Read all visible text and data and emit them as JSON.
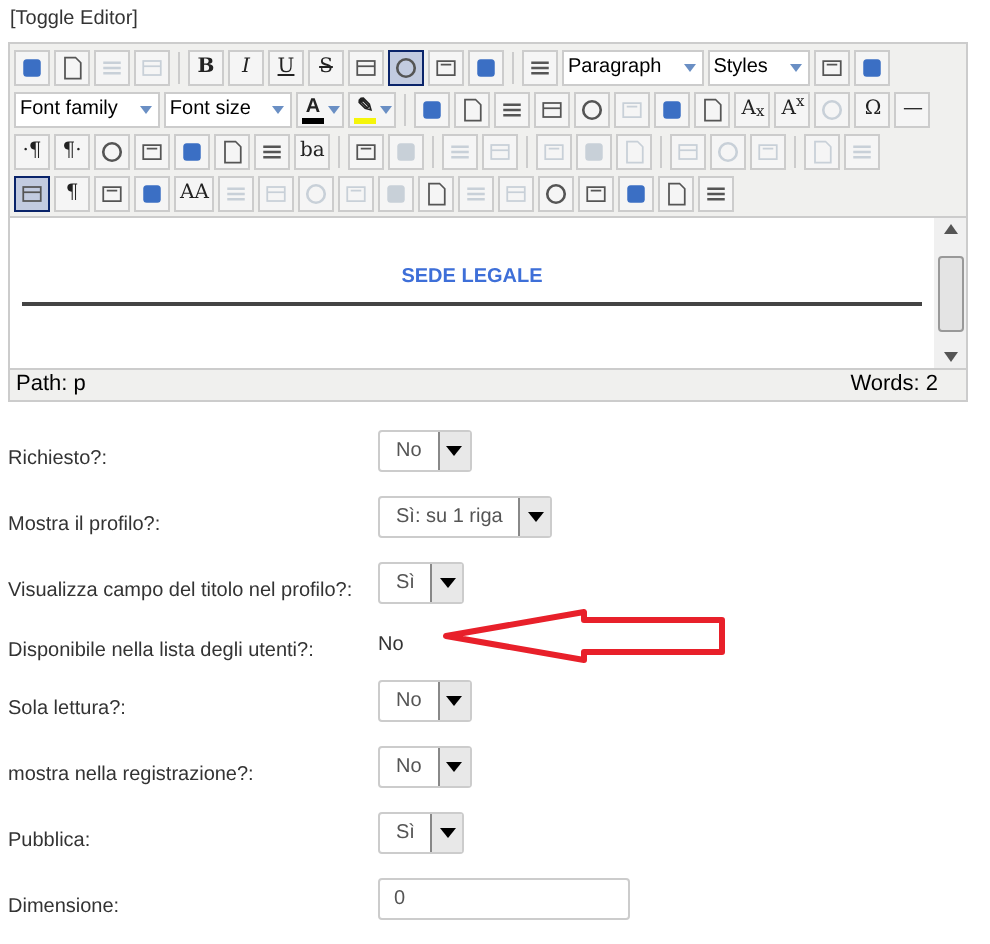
{
  "toggle_link": "[Toggle Editor]",
  "toolbar_rows": [
    [
      {
        "kind": "icon"
      },
      {
        "kind": "icon"
      },
      {
        "kind": "icon",
        "disabled": true
      },
      {
        "kind": "icon",
        "disabled": true
      },
      {
        "kind": "sep"
      },
      {
        "kind": "text",
        "label": "B",
        "bold": true
      },
      {
        "kind": "text",
        "label": "I",
        "italic": true
      },
      {
        "kind": "text",
        "label": "U",
        "underline": true
      },
      {
        "kind": "text",
        "label": "S",
        "strike": true
      },
      {
        "kind": "icon"
      },
      {
        "kind": "icon",
        "selected": true
      },
      {
        "kind": "icon"
      },
      {
        "kind": "icon"
      },
      {
        "kind": "sep"
      },
      {
        "kind": "icon"
      },
      {
        "kind": "select",
        "label": "Paragraph"
      },
      {
        "kind": "select",
        "label": "Styles"
      },
      {
        "kind": "icon"
      },
      {
        "kind": "icon"
      }
    ],
    [
      {
        "kind": "select",
        "label": "Font family"
      },
      {
        "kind": "select",
        "label": "Font size"
      },
      {
        "kind": "split",
        "label": "A",
        "color": "#000000"
      },
      {
        "kind": "split",
        "label": "✎",
        "color": "#f5f50a"
      },
      {
        "kind": "sep"
      },
      {
        "kind": "icon"
      },
      {
        "kind": "icon"
      },
      {
        "kind": "icon"
      },
      {
        "kind": "icon"
      },
      {
        "kind": "icon"
      },
      {
        "kind": "icon",
        "disabled": true
      },
      {
        "kind": "icon"
      },
      {
        "kind": "icon"
      },
      {
        "kind": "text",
        "label": "A$_{x}$"
      },
      {
        "kind": "text",
        "label": "A$^{x}$"
      },
      {
        "kind": "icon",
        "disabled": true
      },
      {
        "kind": "text",
        "label": "Ω"
      },
      {
        "kind": "text",
        "label": "—"
      }
    ],
    [
      {
        "kind": "text",
        "label": "·¶"
      },
      {
        "kind": "text",
        "label": "¶·"
      },
      {
        "kind": "icon"
      },
      {
        "kind": "icon"
      },
      {
        "kind": "icon"
      },
      {
        "kind": "icon"
      },
      {
        "kind": "icon"
      },
      {
        "kind": "text",
        "label": "ba"
      },
      {
        "kind": "sep"
      },
      {
        "kind": "icon"
      },
      {
        "kind": "icon",
        "disabled": true
      },
      {
        "kind": "sep"
      },
      {
        "kind": "icon",
        "disabled": true
      },
      {
        "kind": "icon",
        "disabled": true
      },
      {
        "kind": "sep"
      },
      {
        "kind": "icon",
        "disabled": true
      },
      {
        "kind": "icon",
        "disabled": true
      },
      {
        "kind": "icon",
        "disabled": true
      },
      {
        "kind": "sep"
      },
      {
        "kind": "icon",
        "disabled": true
      },
      {
        "kind": "icon",
        "disabled": true
      },
      {
        "kind": "icon",
        "disabled": true
      },
      {
        "kind": "sep"
      },
      {
        "kind": "icon",
        "disabled": true
      },
      {
        "kind": "icon",
        "disabled": true
      }
    ],
    [
      {
        "kind": "icon",
        "selected": true
      },
      {
        "kind": "text",
        "label": "¶"
      },
      {
        "kind": "icon"
      },
      {
        "kind": "icon"
      },
      {
        "kind": "text",
        "label": "AA"
      },
      {
        "kind": "icon",
        "disabled": true
      },
      {
        "kind": "icon",
        "disabled": true
      },
      {
        "kind": "icon",
        "disabled": true
      },
      {
        "kind": "icon",
        "disabled": true
      },
      {
        "kind": "icon",
        "disabled": true
      },
      {
        "kind": "icon"
      },
      {
        "kind": "icon",
        "disabled": true
      },
      {
        "kind": "icon",
        "disabled": true
      },
      {
        "kind": "icon"
      },
      {
        "kind": "icon"
      },
      {
        "kind": "icon"
      },
      {
        "kind": "icon"
      },
      {
        "kind": "icon"
      }
    ]
  ],
  "content": {
    "heading": "SEDE LEGALE"
  },
  "status_bar": {
    "path": "Path: p",
    "words": "Words: 2"
  },
  "fields": [
    {
      "label": "Richiesto?:",
      "kind": "select",
      "value": "No"
    },
    {
      "label": "Mostra il profilo?:",
      "kind": "select",
      "value": "Sì: su 1 riga"
    },
    {
      "label": "Visualizza campo del titolo nel profilo?:",
      "kind": "select",
      "value": "Sì"
    },
    {
      "label": "Disponibile nella lista degli utenti?:",
      "kind": "static",
      "value": "No",
      "annotated": true
    },
    {
      "label": "Sola lettura?:",
      "kind": "select",
      "value": "No"
    },
    {
      "label": "mostra nella registrazione?:",
      "kind": "select",
      "value": "No"
    },
    {
      "label": "Pubblica:",
      "kind": "select",
      "value": "Sì"
    },
    {
      "label": "Dimensione:",
      "kind": "input",
      "value": "0"
    }
  ]
}
